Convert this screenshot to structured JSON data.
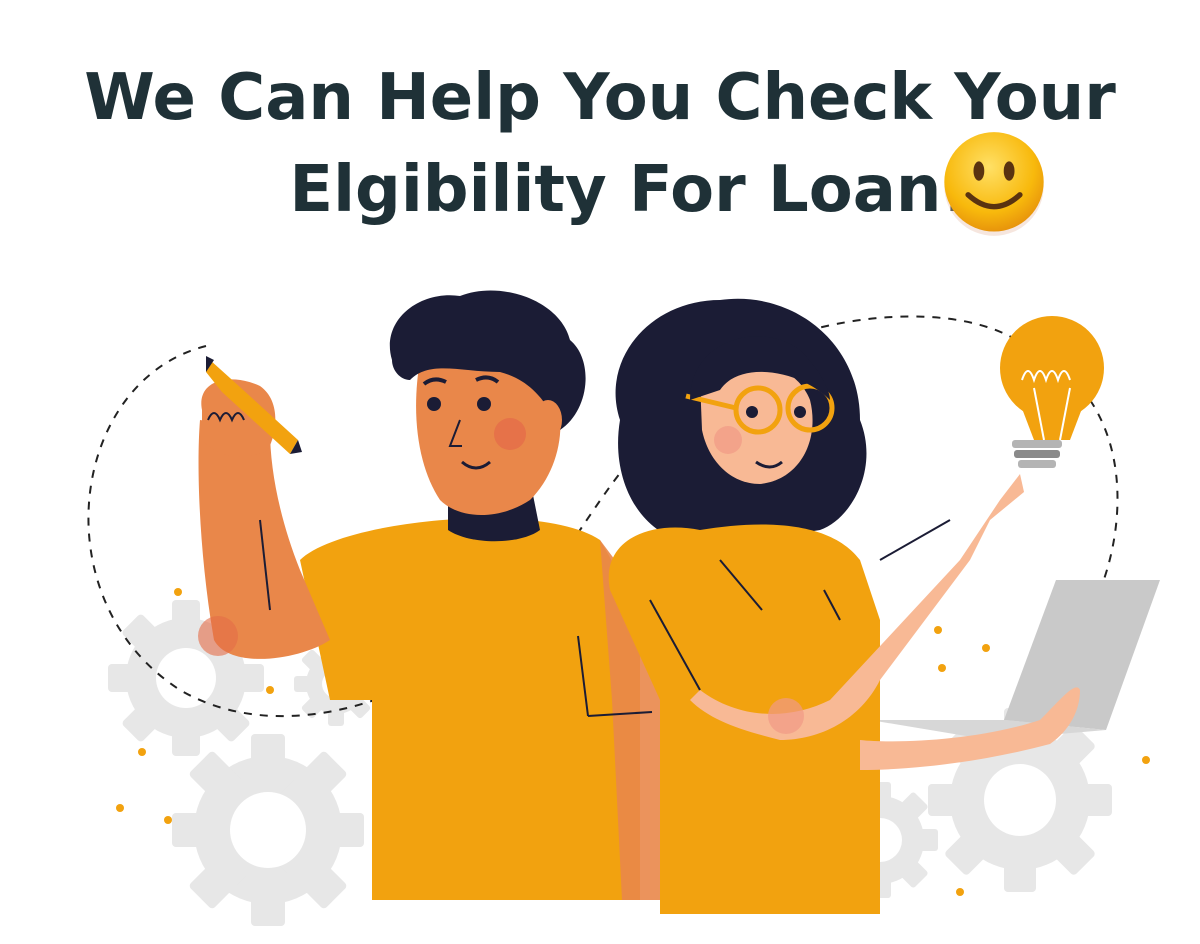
{
  "headline": {
    "line1": "We Can Help You Check Your",
    "line2": "Elgibility For Loan!"
  },
  "emoji": {
    "name": "smiling-face-emoji"
  },
  "illustration": {
    "subject": "two-people-collaborating",
    "colors": {
      "shirt": "#f2a20f",
      "skin_man": "#e9874a",
      "skin_woman": "#f8b995",
      "hair": "#1b1c35",
      "gear": "#e7e7e7",
      "bulb": "#f2a20f",
      "laptop": "#c9c9c9",
      "title_text": "#1f3137"
    }
  }
}
